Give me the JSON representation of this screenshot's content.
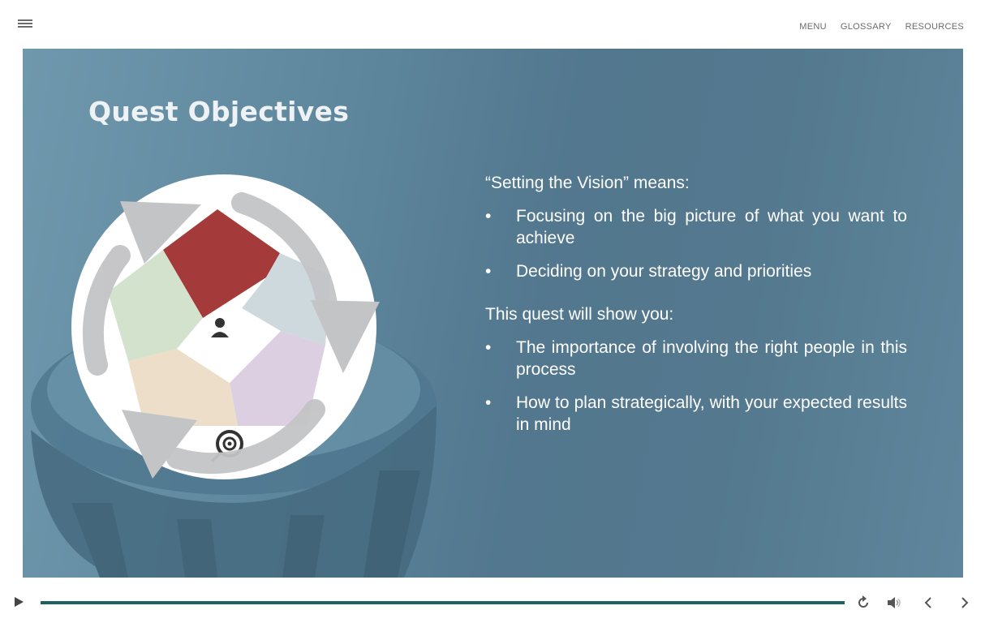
{
  "topnav": {
    "menu_icon": "hamburger-icon",
    "links": [
      "MENU",
      "GLOSSARY",
      "RESOURCES"
    ]
  },
  "slide": {
    "title": "Quest Objectives",
    "intro1": "“Setting the Vision” means:",
    "bullets1": [
      "Focusing on the big picture of what you want to achieve",
      "Deciding on your strategy and priorities"
    ],
    "intro2": "This quest will show you:",
    "bullets2": [
      "The importance of involving the right people in this process",
      "How to plan strategically, with your expected results in mind"
    ]
  },
  "player": {
    "progress": 1.0,
    "icons": [
      "play-icon",
      "replay-icon",
      "volume-icon",
      "previous-icon",
      "next-icon"
    ]
  },
  "colors": {
    "slide_bg": "#5a8298",
    "progress_fill": "#1f5e63",
    "red_segment": "#a53a3a"
  }
}
